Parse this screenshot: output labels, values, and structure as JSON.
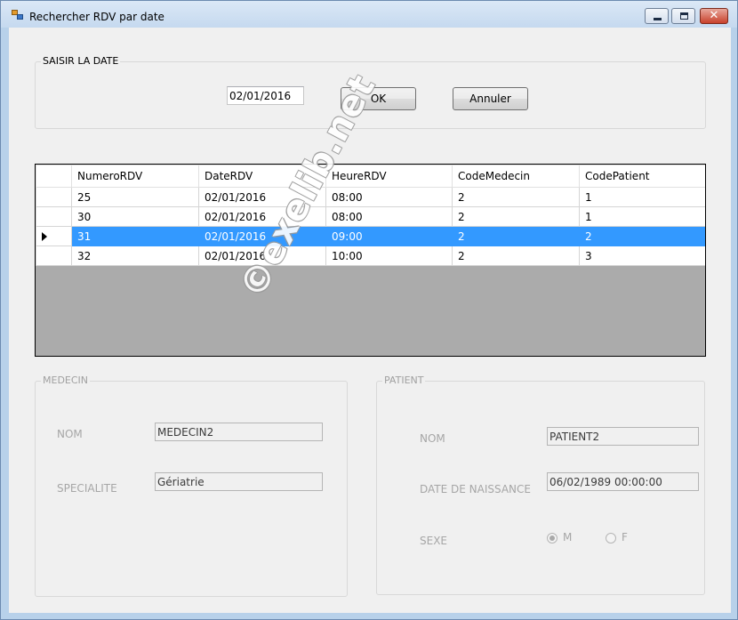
{
  "window": {
    "title": "Rechercher RDV par date"
  },
  "date_group": {
    "title": "SAISIR LA DATE",
    "date_value": "02/01/2016",
    "ok_label": "OK",
    "cancel_label": "Annuler"
  },
  "grid": {
    "columns": [
      "NumeroRDV",
      "DateRDV",
      "HeureRDV",
      "CodeMedecin",
      "CodePatient"
    ],
    "rows": [
      [
        "25",
        "02/01/2016",
        "08:00",
        "2",
        "1"
      ],
      [
        "30",
        "02/01/2016",
        "08:00",
        "2",
        "1"
      ],
      [
        "31",
        "02/01/2016",
        "09:00",
        "2",
        "2"
      ],
      [
        "32",
        "02/01/2016",
        "10:00",
        "2",
        "3"
      ]
    ],
    "selected_row_index": 2
  },
  "medecin": {
    "title": "MEDECIN",
    "nom_label": "NOM",
    "nom_value": "MEDECIN2",
    "specialite_label": "SPECIALITE",
    "specialite_value": "Gériatrie"
  },
  "patient": {
    "title": "PATIENT",
    "nom_label": "NOM",
    "nom_value": "PATIENT2",
    "naissance_label": "DATE DE NAISSANCE",
    "naissance_value": "06/02/1989 00:00:00",
    "sexe_label": "SEXE",
    "sexe_options": [
      "M",
      "F"
    ],
    "sexe_selected": "M"
  },
  "watermark": "©exelib.net",
  "colors": {
    "selection": "#3399ff",
    "grid_background": "#ababab",
    "form_background": "#f0f0f0"
  }
}
